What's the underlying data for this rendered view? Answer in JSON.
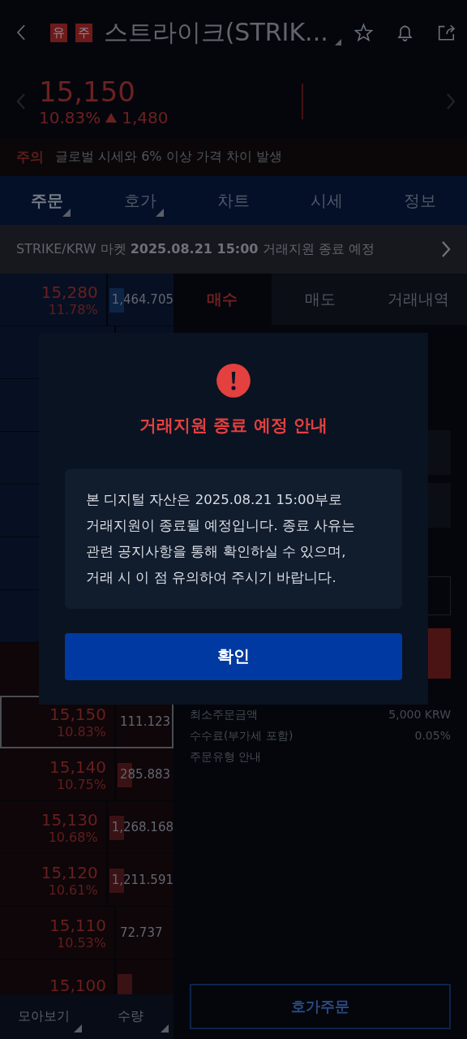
{
  "header": {
    "badges": [
      "유",
      "주"
    ],
    "title": "스트라이크(STRIK..."
  },
  "price": {
    "value": "15,150",
    "rate": "10.83%",
    "change": "1,480"
  },
  "notice": {
    "label": "주의",
    "text": "글로벌 시세와 6% 이상 가격 차이 발생"
  },
  "tabs": [
    {
      "label": "주문",
      "selected": true,
      "dropdown": true
    },
    {
      "label": "호가",
      "selected": false,
      "dropdown": true
    },
    {
      "label": "차트",
      "selected": false,
      "dropdown": false
    },
    {
      "label": "시세",
      "selected": false,
      "dropdown": false
    },
    {
      "label": "정보",
      "selected": false,
      "dropdown": false
    }
  ],
  "banner": {
    "text": "STRIKE/KRW 마켓 **2025.08.21 15:00** 거래지원 종료 예정"
  },
  "orderbook": {
    "rows": [
      {
        "kind": "ask",
        "selected": false,
        "price": "15,280",
        "rate": "11.78%",
        "quantity": "1,464.705",
        "volume_bar": true
      },
      {
        "kind": "ask",
        "selected": false
      },
      {
        "kind": "ask",
        "selected": false
      },
      {
        "kind": "ask",
        "selected": false
      },
      {
        "kind": "ask",
        "selected": false
      },
      {
        "kind": "ask",
        "selected": false
      },
      {
        "kind": "ask",
        "selected": false
      },
      {
        "kind": "bid",
        "selected": false
      },
      {
        "kind": "bid",
        "selected": true,
        "price": "15,150",
        "rate": "10.83%",
        "quantity": "111.123"
      },
      {
        "kind": "bid",
        "selected": false,
        "price": "15,140",
        "rate": "10.75%",
        "quantity": "285.883",
        "volume_bar": true
      },
      {
        "kind": "bid",
        "selected": false,
        "price": "15,130",
        "rate": "10.68%",
        "quantity": "1,268.168",
        "volume_bar": true
      },
      {
        "kind": "bid",
        "selected": false,
        "price": "15,120",
        "rate": "10.61%",
        "quantity": "1,211.591",
        "volume_bar": true
      },
      {
        "kind": "bid",
        "selected": false,
        "price": "15,110",
        "rate": "10.53%",
        "quantity": "72.737"
      },
      {
        "kind": "bid",
        "selected": false,
        "price": "15,100",
        "volume_bar": true
      }
    ],
    "footer": [
      "모아보기",
      "수량"
    ]
  },
  "order_panel": {
    "tabs": [
      {
        "label": "매수",
        "selected": true
      },
      {
        "label": "매도",
        "selected": false
      },
      {
        "label": "거래내역",
        "selected": false
      }
    ],
    "info": [
      {
        "label": "최소주문금액",
        "value": "5,000 KRW"
      },
      {
        "label": "수수료(부가세 포함)",
        "value": "0.05%"
      },
      {
        "label": "주문유형 안내"
      }
    ],
    "order_button": "호가주문"
  },
  "modal": {
    "title": "거래지원 종료 예정 안내",
    "body": "본 디지털 자산은 2025.08.21 15:00부로\n거래지원이 종료될 예정입니다. 종료 사유는\n관련 공지사항을 통해 확인하실 수 있으며,\n거래 시 이 점 유의하여 주시기 바랍니다.",
    "confirm": "확인"
  }
}
